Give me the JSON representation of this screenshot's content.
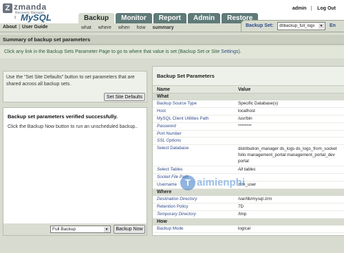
{
  "header": {
    "logo": {
      "brand": "zmanda",
      "sub": "Recovery Manager",
      "for": "for",
      "product": "MySQL"
    },
    "user": "admin",
    "logout": "Log Out",
    "tabs": [
      "Backup",
      "Monitor",
      "Report",
      "Admin",
      "Restore"
    ],
    "active_tab": "Backup"
  },
  "subbar": {
    "about": "About",
    "user_guide": "User Guide",
    "nav": [
      "what",
      "where",
      "when",
      "how",
      "summary"
    ],
    "selected": "summary"
  },
  "backup_set": {
    "label": "Backup Set:",
    "value": "dbbackup_full_logx",
    "arrow": "▼",
    "lang": "En"
  },
  "section_title": "Summary of backup set parameters",
  "notice": {
    "prefix": "Click any link in the Backup Sets Parameter Page to go to where that value is set (Backup Set or Site ",
    "link": "Settings",
    "suffix": ")."
  },
  "left_top": {
    "text": "Use the \"Set Site Defaults\" button to set parameters that are shared across all backup sets.",
    "button": "Set Site Defaults"
  },
  "left_bottom": {
    "title": "Backup set parameters verified successfully.",
    "text": "Click the Backup Now button to run an unscheduled backup..",
    "select": "Full Backup",
    "select_arrow": "▼",
    "button": "Backup Now"
  },
  "params": {
    "title": "Backup Set Parameters",
    "col_name": "Name",
    "col_value": "Value",
    "groups": {
      "what": "What",
      "where": "Where",
      "how": "How"
    },
    "rows": [
      {
        "name": "Backup Source Type",
        "value": "Specific Database(s)"
      },
      {
        "name": "Host",
        "value": "localhost"
      },
      {
        "name": "MySQL Client Utilities Path",
        "value": "/usr/bin"
      },
      {
        "name": "Password",
        "value": "********"
      },
      {
        "name": "Port Number",
        "value": ""
      },
      {
        "name": "SSL Options",
        "value": ""
      },
      {
        "name": "Select Database",
        "value": "distribution_manager ds_logs ds_logs_from_socket folio management_portal management_portal_dev portal"
      },
      {
        "name": "Select Tables",
        "value": "All tables"
      },
      {
        "name": "Socket File Path",
        "value": ""
      },
      {
        "name": "Username",
        "value": "zrm_user"
      },
      {
        "name": "Destination Directory",
        "value": "/var/lib/mysql-zrm"
      },
      {
        "name": "Retention Policy",
        "value": "7D"
      },
      {
        "name": "Temporary Directory",
        "value": "/tmp"
      },
      {
        "name": "Backup Mode",
        "value": "logical"
      }
    ]
  },
  "watermark": {
    "letter": "T",
    "text": "aimienphi"
  },
  "colors": {
    "tab_bg": "#5f7a78",
    "link": "#2e4a8a",
    "panel_bg": "#eef0ea"
  }
}
